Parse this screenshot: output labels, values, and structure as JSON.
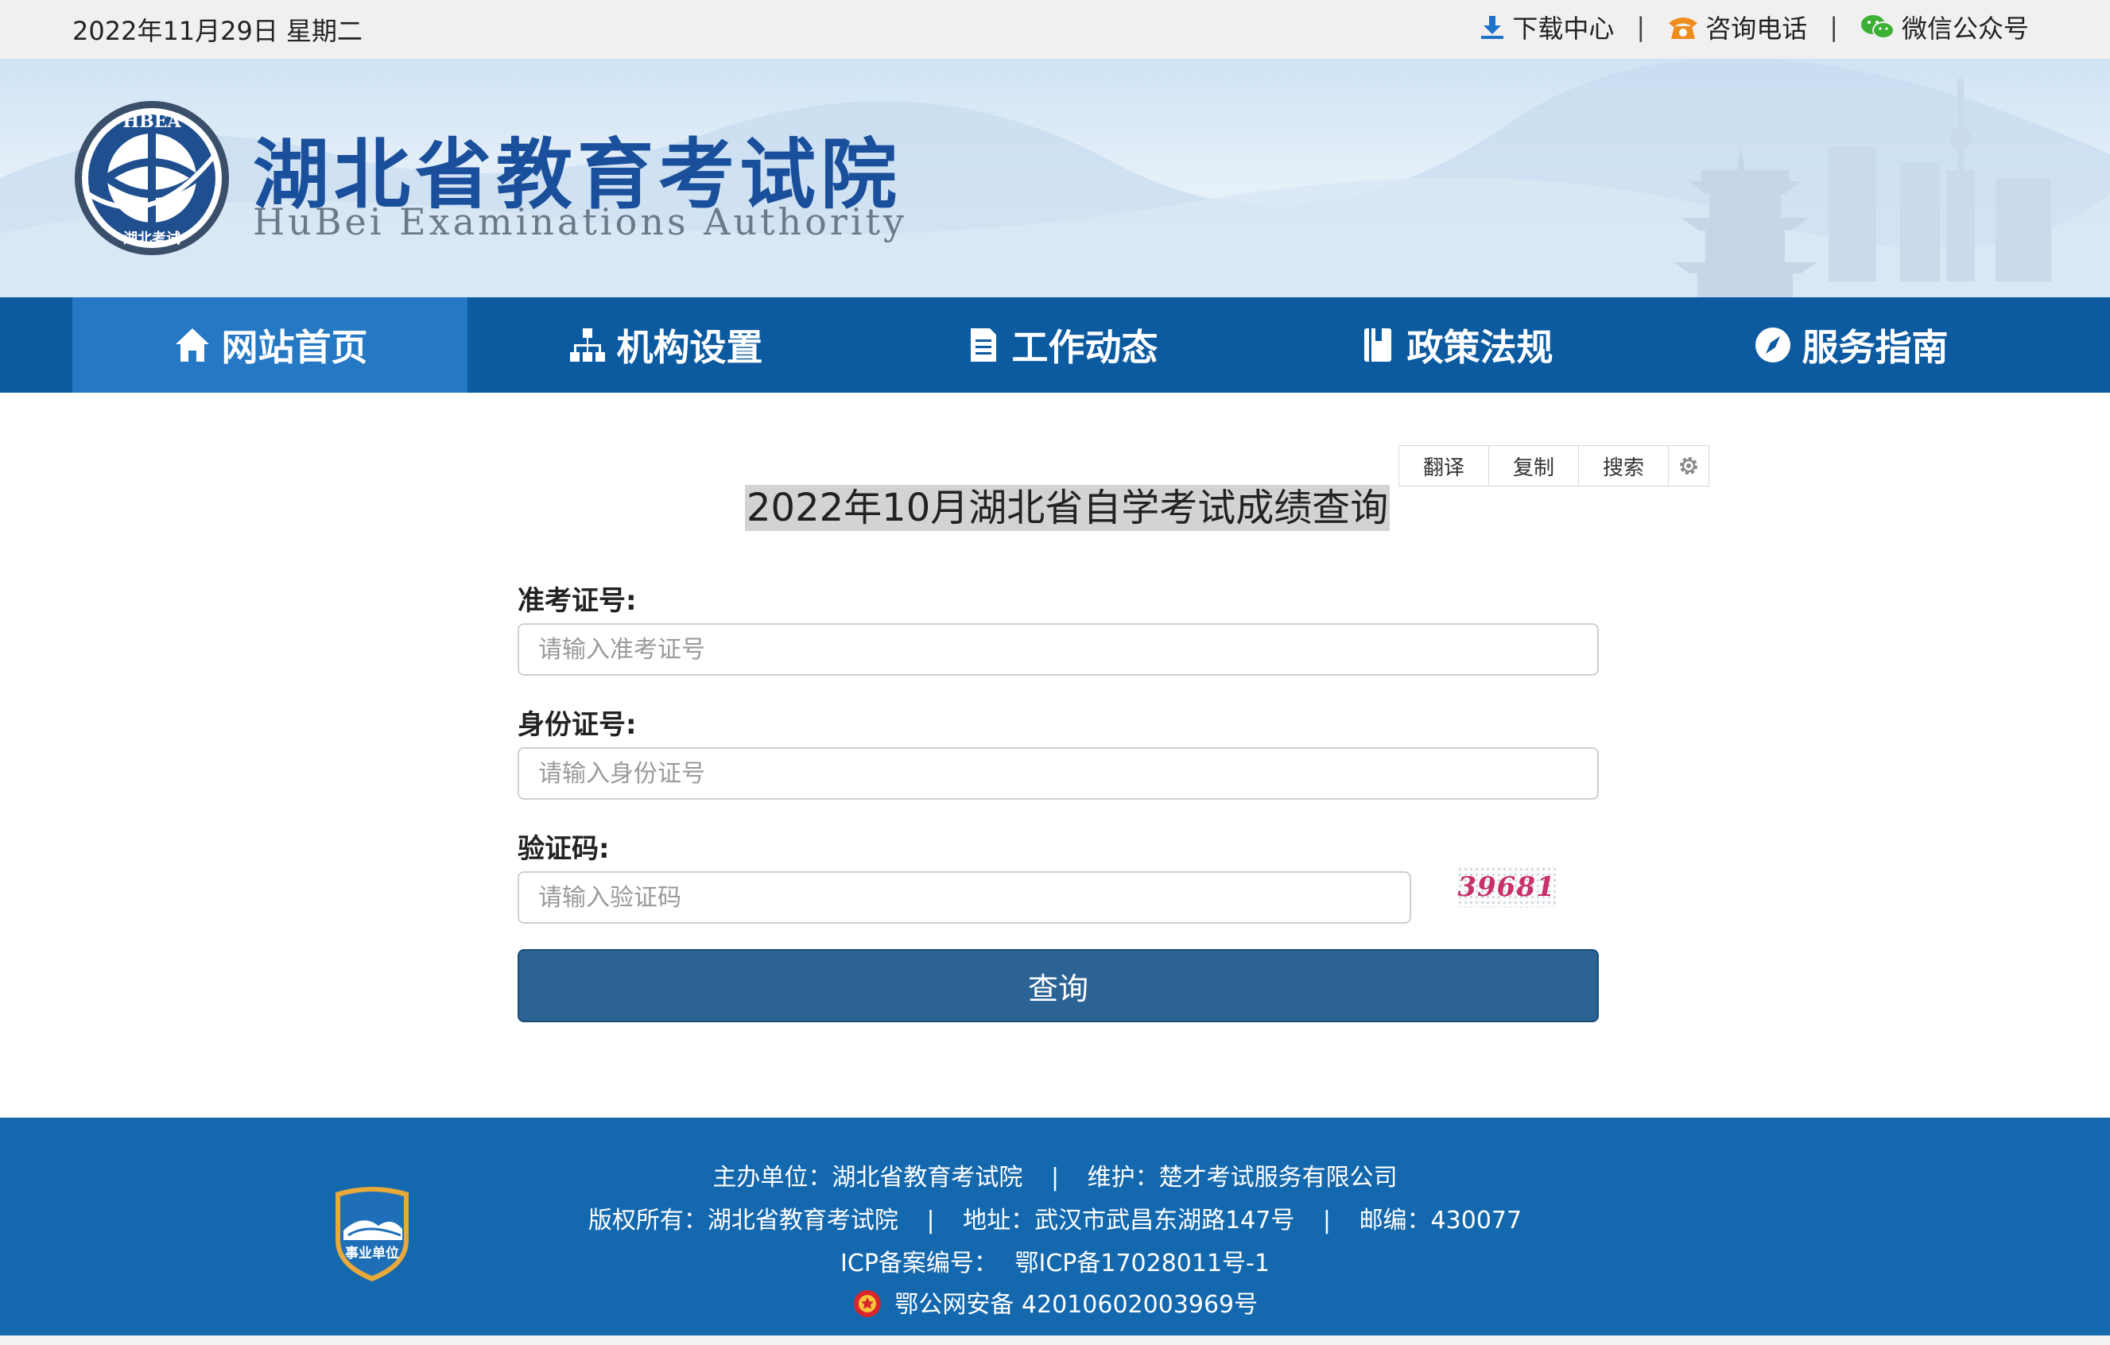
{
  "topbar": {
    "date": "2022年11月29日 星期二",
    "links": [
      {
        "label": "下载中心",
        "icon": "download-icon",
        "color": "#1e73c8"
      },
      {
        "label": "咨询电话",
        "icon": "phone-icon",
        "color": "#f08c1e"
      },
      {
        "label": "微信公众号",
        "icon": "wechat-icon",
        "color": "#3cb034"
      }
    ],
    "separator": "|"
  },
  "header": {
    "logo_text": "HBEA",
    "logo_subtext": "湖北考试",
    "title_cn": "湖北省教育考试院",
    "title_en": "HuBei Examinations Authority"
  },
  "nav": {
    "items": [
      {
        "label": "网站首页",
        "icon": "home-icon",
        "active": true
      },
      {
        "label": "机构设置",
        "icon": "org-chart-icon",
        "active": false
      },
      {
        "label": "工作动态",
        "icon": "document-icon",
        "active": false
      },
      {
        "label": "政策法规",
        "icon": "book-icon",
        "active": false
      },
      {
        "label": "服务指南",
        "icon": "compass-icon",
        "active": false
      }
    ]
  },
  "tools": {
    "translate": "翻译",
    "copy": "复制",
    "search": "搜索",
    "settings_icon": "gear-icon"
  },
  "form": {
    "title": "2022年10月湖北省自学考试成绩查询",
    "fields": [
      {
        "label": "准考证号:",
        "placeholder": "请输入准考证号",
        "value": ""
      },
      {
        "label": "身份证号:",
        "placeholder": "请输入身份证号",
        "value": ""
      },
      {
        "label": "验证码:",
        "placeholder": "请输入验证码",
        "value": ""
      }
    ],
    "captcha_text": "39681",
    "submit_label": "查询"
  },
  "footer": {
    "badge_text": "事业单位",
    "line1": {
      "host": "主办单位：湖北省教育考试院",
      "maintainer": "维护：楚才考试服务有限公司"
    },
    "line2": {
      "copyright": "版权所有：湖北省教育考试院",
      "address": "地址：武汉市武昌东湖路147号",
      "postcode": "邮编：430077"
    },
    "line3": {
      "icp_label": "ICP备案编号：",
      "icp_value": "鄂ICP备17028011号-1"
    },
    "line4": {
      "police": "鄂公网安备 42010602003969号"
    },
    "separator": "|"
  },
  "colors": {
    "nav_bg": "#0c5aa0",
    "nav_active": "#2478c4",
    "footer_bg": "#1468ae",
    "button_bg": "#2c6395",
    "title_blue": "#1a4f9c"
  }
}
